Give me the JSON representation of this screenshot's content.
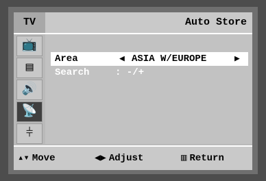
{
  "header": {
    "tag": "TV",
    "title": "Auto Store"
  },
  "sidebar": {
    "items": [
      {
        "icon": "picture-icon",
        "glyph": "📺",
        "active": false
      },
      {
        "icon": "channel-list-icon",
        "glyph": "▤",
        "active": false
      },
      {
        "icon": "speaker-icon",
        "glyph": "🔊",
        "active": false
      },
      {
        "icon": "satellite-dish-icon",
        "glyph": "📡",
        "active": true
      },
      {
        "icon": "settings-sliders-icon",
        "glyph": "⫩",
        "active": false
      }
    ]
  },
  "menu": {
    "area": {
      "label": "Area",
      "value": "ASIA W/EUROPE",
      "left_arrow": "◀",
      "right_arrow": "▶"
    },
    "search": {
      "label": "Search",
      "value": ":   -/+"
    }
  },
  "footer": {
    "move": {
      "glyph": "▴▾",
      "label": "Move"
    },
    "adjust": {
      "glyph": "◀▶",
      "label": "Adjust"
    },
    "return": {
      "glyph": "▥",
      "label": "Return"
    }
  }
}
